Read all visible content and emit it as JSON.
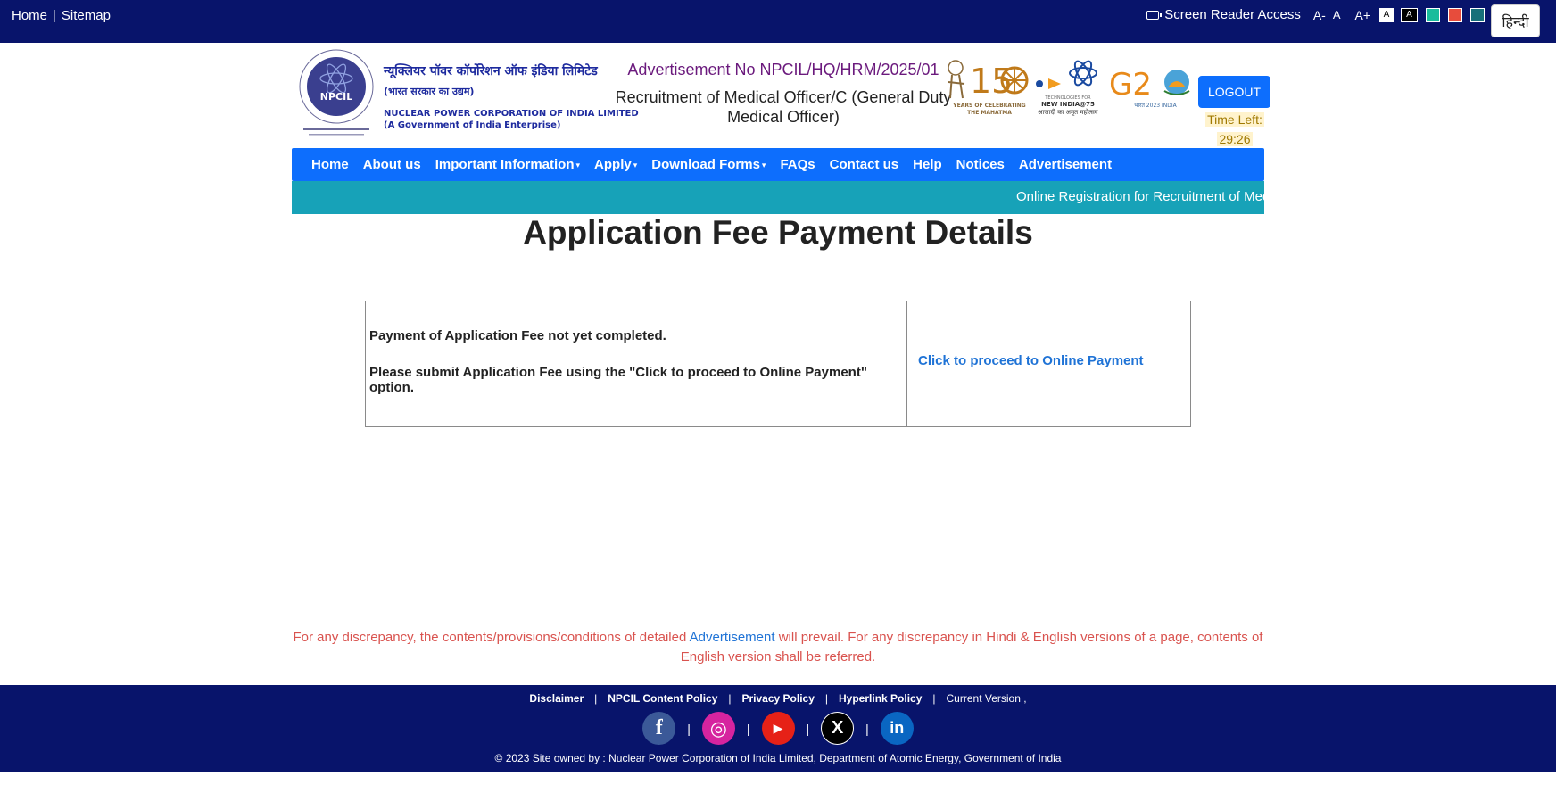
{
  "topbar": {
    "home": "Home",
    "sitemap": "Sitemap",
    "screen_reader": "Screen Reader Access",
    "font_decrease": "A-",
    "font_normal": "A",
    "font_increase": "A+",
    "contrast_light": "A",
    "contrast_dark": "A",
    "theme_colors": [
      "#1abc9c",
      "#e74c3c",
      "#17707a"
    ],
    "language_button": "हिन्दी"
  },
  "header": {
    "org_hindi": "न्यूक्लियर पॉवर कॉर्पोरेशन ऑफ इंडिया लिमिटेड",
    "org_hindi_sub": "(भारत सरकार का उद्यम)",
    "org_english": "NUCLEAR POWER CORPORATION OF INDIA LIMITED",
    "org_english_sub": "(A Government of India Enterprise)",
    "emblem_text": "NPCIL",
    "advertisement_no": "Advertisement No NPCIL/HQ/HRM/2025/01",
    "post_name": "Recruitment of Medical Officer/C (General Duty Medical Officer)",
    "logos": {
      "gandhi": "150 YEARS OF CELEBRATING THE MAHATMA",
      "new_india_top": "TECHNOLOGIES FOR",
      "new_india": "NEW INDIA@75",
      "new_india_hindi": "आजादी का अमृत महोत्सव",
      "g20": "G20"
    },
    "logout_label": "LOGOUT",
    "time_left_label": "Time Left:",
    "time_left_value": "29:26"
  },
  "nav": {
    "items": [
      {
        "label": "Home",
        "dropdown": false
      },
      {
        "label": "About us",
        "dropdown": false
      },
      {
        "label": "Important Information",
        "dropdown": true
      },
      {
        "label": "Apply",
        "dropdown": true
      },
      {
        "label": "Download Forms",
        "dropdown": true
      },
      {
        "label": "FAQs",
        "dropdown": false
      },
      {
        "label": "Contact us",
        "dropdown": false
      },
      {
        "label": "Help",
        "dropdown": false
      },
      {
        "label": "Notices",
        "dropdown": false
      },
      {
        "label": "Advertisement",
        "dropdown": false
      }
    ],
    "marquee": "Online Registration for Recruitment of Med"
  },
  "main": {
    "title": "Application Fee Payment Details",
    "status_line1": "Payment of Application Fee not yet completed.",
    "status_line2": "Please submit Application Fee using the \"Click to proceed to Online Payment\" option.",
    "payment_link": "Click to proceed to Online Payment"
  },
  "disclaimer": {
    "part1": "For any discrepancy, the contents/provisions/conditions of detailed ",
    "link": "Advertisement",
    "part2": " will prevail. For any discrepancy in Hindi & English versions of a page, contents of English version shall be referred."
  },
  "footer": {
    "links": [
      "Disclaimer",
      "NPCIL Content Policy",
      "Privacy Policy",
      "Hyperlink Policy"
    ],
    "version": "Current Version ,",
    "socials": [
      {
        "name": "facebook-icon",
        "glyph": "f",
        "color": "#3b5998"
      },
      {
        "name": "instagram-icon",
        "glyph": "◎",
        "color": "#d6249f"
      },
      {
        "name": "youtube-icon",
        "glyph": "▶",
        "color": "#e62117"
      },
      {
        "name": "x-twitter-icon",
        "glyph": "X",
        "color": "#000000"
      },
      {
        "name": "linkedin-icon",
        "glyph": "in",
        "color": "#0a66c2"
      }
    ],
    "copyright": "© 2023 Site owned by : Nuclear Power Corporation of India Limited, Department of Atomic Energy, Government of India"
  }
}
